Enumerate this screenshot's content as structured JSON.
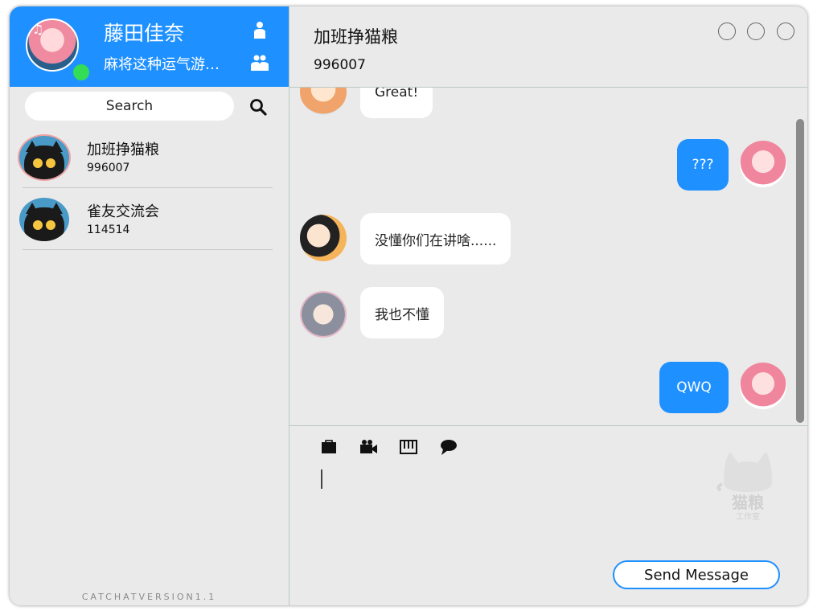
{
  "profile": {
    "name": "藤田佳奈",
    "status": "麻将这种运气游…",
    "online_color": "#33dd55"
  },
  "search": {
    "label": "Search"
  },
  "contacts": [
    {
      "name": "加班挣猫粮",
      "id": "996007",
      "active": true
    },
    {
      "name": "雀友交流会",
      "id": "114514",
      "active": false
    }
  ],
  "version": "CATCHATVERSION1.1",
  "chat": {
    "title": "加班挣猫粮",
    "id": "996007"
  },
  "messages": [
    {
      "from": "other",
      "text": "Great!"
    },
    {
      "from": "me",
      "text": "???"
    },
    {
      "from": "other",
      "text": "没懂你们在讲啥......"
    },
    {
      "from": "other",
      "text": "我也不懂"
    },
    {
      "from": "me",
      "text": "QWQ"
    }
  ],
  "toolbar": {
    "icons": [
      "folder-icon",
      "video-camera-icon",
      "piano-icon",
      "chat-bubble-icon"
    ]
  },
  "composer": {
    "send_label": "Send Message"
  },
  "watermark": {
    "text": "猫粮",
    "subtext": "工作室"
  },
  "colors": {
    "accent": "#1e90ff",
    "background": "#eaeaea",
    "bubble_other": "#ffffff"
  }
}
